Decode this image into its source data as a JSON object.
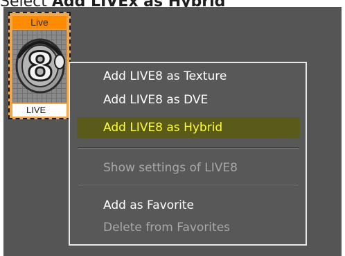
{
  "caption": {
    "prefix": "Select ",
    "bold": "Add LIVEx as Hybrid"
  },
  "tile": {
    "header": "Live",
    "badge_digit": "8",
    "footer": "LIVE"
  },
  "context_menu": {
    "items": [
      {
        "label": "Add LIVE8 as Texture",
        "enabled": true,
        "highlighted": false
      },
      {
        "label": "Add LIVE8 as DVE",
        "enabled": true,
        "highlighted": false
      },
      {
        "label": "Add LIVE8 as Hybrid",
        "enabled": true,
        "highlighted": true
      },
      {
        "label": "Show settings of LIVE8",
        "enabled": false,
        "highlighted": false
      },
      {
        "label": "Add as Favorite",
        "enabled": true,
        "highlighted": false
      },
      {
        "label": "Delete from Favorites",
        "enabled": false,
        "highlighted": false
      }
    ]
  },
  "colors": {
    "app_background": "#555555",
    "menu_background": "#585858",
    "highlight_background": "#5a5a1a",
    "highlight_text": "#ffff33",
    "tile_header": "#ff8c00",
    "tile_frame": "#f0a64a"
  }
}
